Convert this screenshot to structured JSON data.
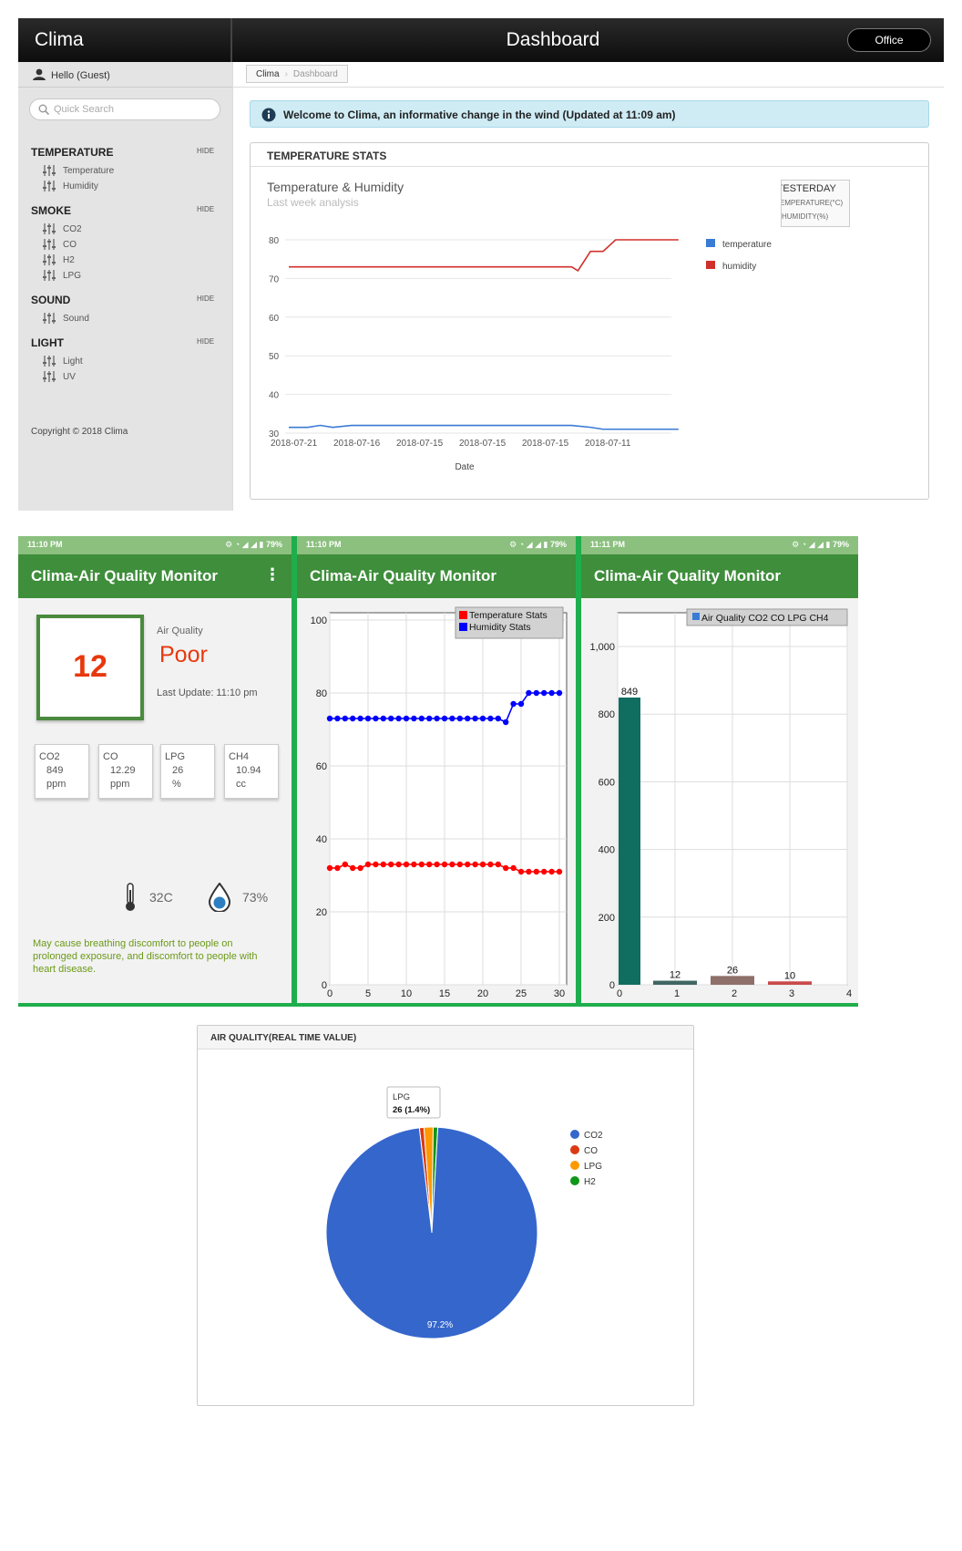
{
  "web": {
    "brand": "Clima",
    "title": "Dashboard",
    "office_button": "Office",
    "greeting": "Hello (Guest)",
    "search_placeholder": "Quick Search",
    "sections": [
      {
        "title": "TEMPERATURE",
        "hide": "HIDE",
        "items": [
          "Temperature",
          "Humidity"
        ]
      },
      {
        "title": "SMOKE",
        "hide": "HIDE",
        "items": [
          "CO2",
          "CO",
          "H2",
          "LPG"
        ]
      },
      {
        "title": "SOUND",
        "hide": "HIDE",
        "items": [
          "Sound"
        ]
      },
      {
        "title": "LIGHT",
        "hide": "HIDE",
        "items": [
          "Light",
          "UV"
        ]
      }
    ],
    "copyright": "Copyright © 2018 Clima",
    "breadcrumb": [
      "Clima",
      "Dashboard"
    ],
    "welcome": "Welcome to Clima, an informative change in the wind (Updated at 11:09 am)",
    "panel_title": "TEMPERATURE STATS",
    "chart_title": "Temperature & Humidity",
    "chart_subtitle": "Last week analysis",
    "toggle": {
      "line1": "YESTERDAY",
      "line2": "TEMPERATURE(°C)",
      "line3": "HUMIDITY(%)"
    }
  },
  "phones": [
    {
      "time": "11:10 PM",
      "battery": "79%",
      "title": "Clima-Air Quality Monitor"
    },
    {
      "time": "11:10 PM",
      "battery": "79%",
      "title": "Clima-Air Quality Monitor"
    },
    {
      "time": "11:11 PM",
      "battery": "79%",
      "title": "Clima-Air Quality Monitor"
    }
  ],
  "monitor": {
    "aqi_value": "12",
    "aq_label": "Air Quality",
    "aq_status": "Poor",
    "last_update": "Last Update: 11:10 pm",
    "gases": [
      {
        "name": "CO2",
        "value": "849",
        "unit": "ppm"
      },
      {
        "name": "CO",
        "value": "12.29",
        "unit": "ppm"
      },
      {
        "name": "LPG",
        "value": "26",
        "unit": "%"
      },
      {
        "name": "CH4",
        "value": "10.94",
        "unit": "cc"
      }
    ],
    "temperature": "32C",
    "humidity": "73%",
    "warning": "May cause breathing discomfort to people on prolonged exposure, and discomfort to people with heart disease.",
    "colors": {
      "accent": "#3e8e3b",
      "status": "#e8380d",
      "warning": "#6b9a18"
    }
  },
  "pie_panel": {
    "title": "AIR QUALITY(REAL TIME VALUE)"
  },
  "chart_data": [
    {
      "type": "line",
      "title": "Temperature & Humidity",
      "subtitle": "Last week analysis",
      "xlabel": "Date",
      "ylabel": "",
      "x": [
        "2018-07-21",
        "2018-07-16",
        "2018-07-15",
        "2018-07-15",
        "2018-07-15",
        "2018-07-11"
      ],
      "ylim": [
        30,
        80
      ],
      "yticks": [
        30,
        40,
        50,
        60,
        70,
        80
      ],
      "legend": "right",
      "grid": true,
      "legend_names": [
        "temperature",
        "humidity"
      ],
      "series": [
        {
          "color": "#d0302a",
          "points": [
            [
              0,
              73
            ],
            [
              0.5,
              73
            ],
            [
              1,
              73
            ],
            [
              1.5,
              73
            ],
            [
              2,
              73
            ],
            [
              2.5,
              73
            ],
            [
              3,
              73
            ],
            [
              3.5,
              73
            ],
            [
              4,
              73
            ],
            [
              4.5,
              73
            ],
            [
              4.6,
              72
            ],
            [
              4.8,
              77
            ],
            [
              5,
              77
            ],
            [
              5.2,
              80
            ],
            [
              5.5,
              80
            ],
            [
              5.8,
              80
            ],
            [
              6.2,
              80
            ]
          ]
        },
        {
          "color": "#3a7bd5",
          "points": [
            [
              0,
              31.5
            ],
            [
              0.3,
              31.5
            ],
            [
              0.5,
              32
            ],
            [
              0.7,
              31.5
            ],
            [
              1,
              32
            ],
            [
              1.5,
              32
            ],
            [
              2,
              32
            ],
            [
              2.5,
              32
            ],
            [
              3,
              32
            ],
            [
              3.5,
              32
            ],
            [
              4,
              32
            ],
            [
              4.5,
              32
            ],
            [
              4.8,
              31.5
            ],
            [
              5,
              31
            ],
            [
              5.5,
              31
            ],
            [
              6,
              31
            ],
            [
              6.2,
              31
            ]
          ]
        }
      ]
    },
    {
      "type": "scatter",
      "xlim": [
        0,
        30
      ],
      "ylim": [
        0,
        100
      ],
      "xticks": [
        0,
        5,
        10,
        15,
        20,
        25,
        30
      ],
      "yticks": [
        0,
        20,
        40,
        60,
        80,
        100
      ],
      "legend": "top-right",
      "series": [
        {
          "name": "Temperature Stats",
          "color": "#ff0000",
          "x": [
            0,
            1,
            2,
            3,
            4,
            5,
            6,
            7,
            8,
            9,
            10,
            11,
            12,
            13,
            14,
            15,
            16,
            17,
            18,
            19,
            20,
            21,
            22,
            23,
            24,
            25,
            26,
            27,
            28,
            29,
            30
          ],
          "y": [
            32,
            32,
            33,
            32,
            32,
            33,
            33,
            33,
            33,
            33,
            33,
            33,
            33,
            33,
            33,
            33,
            33,
            33,
            33,
            33,
            33,
            33,
            33,
            32,
            32,
            31,
            31,
            31,
            31,
            31,
            31
          ]
        },
        {
          "name": "Humidity Stats",
          "color": "#0000ff",
          "x": [
            0,
            1,
            2,
            3,
            4,
            5,
            6,
            7,
            8,
            9,
            10,
            11,
            12,
            13,
            14,
            15,
            16,
            17,
            18,
            19,
            20,
            21,
            22,
            23,
            24,
            25,
            26,
            27,
            28,
            29,
            30
          ],
          "y": [
            73,
            73,
            73,
            73,
            73,
            73,
            73,
            73,
            73,
            73,
            73,
            73,
            73,
            73,
            73,
            73,
            73,
            73,
            73,
            73,
            73,
            73,
            73,
            72,
            77,
            77,
            80,
            80,
            80,
            80,
            80
          ]
        }
      ]
    },
    {
      "type": "bar",
      "legend": "top-right",
      "legend_label": "Air Quality CO2 CO LPG CH4",
      "categories": [
        0,
        1,
        2,
        3
      ],
      "values": [
        849,
        12,
        26,
        10
      ],
      "colors": [
        "#0f6e60",
        "#3f6663",
        "#8f6f6a",
        "#c94a4a"
      ],
      "ylim": [
        0,
        1000
      ],
      "yticks": [
        0,
        200,
        400,
        600,
        800,
        "1,000"
      ],
      "xticks": [
        0,
        1,
        2,
        3,
        4
      ]
    },
    {
      "type": "pie",
      "labels": [
        "CO2",
        "CO",
        "LPG",
        "H2"
      ],
      "values": [
        97.2,
        0.7,
        1.4,
        0.7
      ],
      "colors": [
        "#3566cc",
        "#dc3912",
        "#ff9900",
        "#109618"
      ],
      "slice_label": "97.2%",
      "tooltip": {
        "label": "LPG",
        "value": "26 (1.4%)"
      },
      "legend": "right"
    }
  ]
}
